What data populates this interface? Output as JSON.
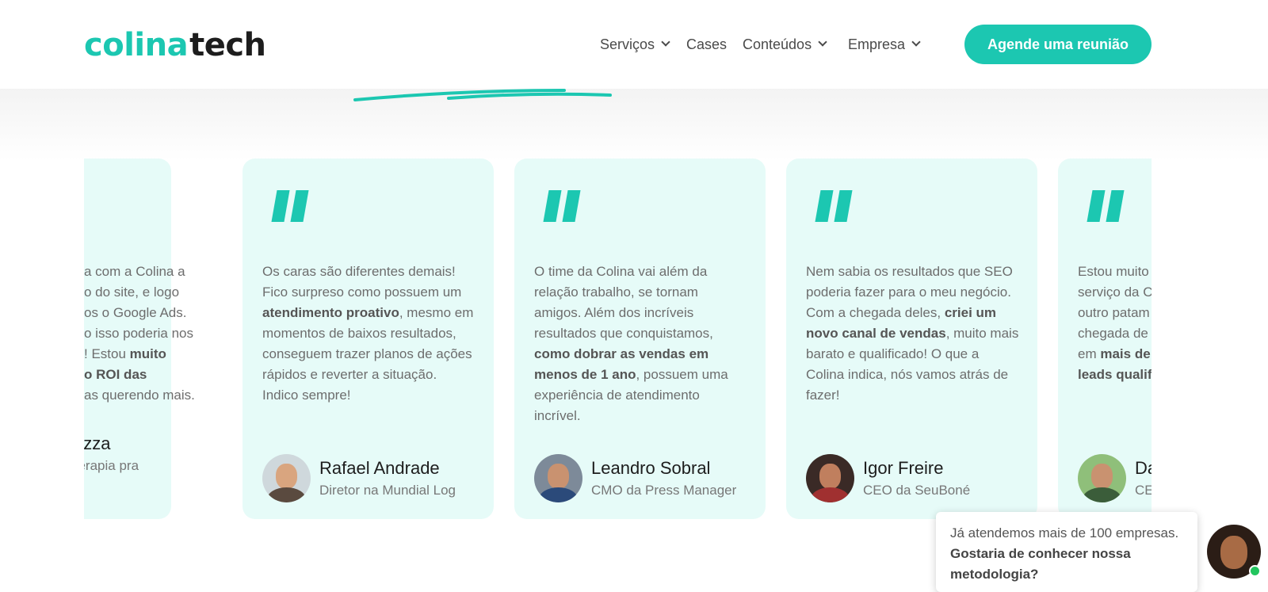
{
  "header": {
    "logo_part1": "colina",
    "logo_part2": "tech",
    "nav": [
      {
        "label": "Serviços",
        "has_dropdown": true
      },
      {
        "label": "Cases",
        "has_dropdown": false
      },
      {
        "label": "Conteúdos",
        "has_dropdown": true
      },
      {
        "label": "Empresa",
        "has_dropdown": true
      }
    ],
    "cta": "Agende uma reunião"
  },
  "colors": {
    "accent": "#1cc7b1",
    "card_bg": "#e6fbf8",
    "text": "#6d6d6d"
  },
  "testimonials": [
    {
      "text_html": "a com a Colina a<br>o do site, e logo<br>os o Google Ads.<br>o isso poderia nos<br>! Estou <b>muito</b><br><b>o ROI das</b><br>as querendo mais.",
      "name": "ina Piazza",
      "role": "a Psicoterapia pra"
    },
    {
      "text_html": "Os caras são diferentes demais! Fico surpreso como possuem um <b>atendimento proativo</b>, mesmo em momentos de baixos resultados, conseguem trazer planos de ações rápidos e reverter a situação. Indico sempre!",
      "name": "Rafael Andrade",
      "role": "Diretor na Mundial Log"
    },
    {
      "text_html": "O time da Colina vai além da relação trabalho, se tornam amigos. Além dos incríveis resultados que conquistamos, <b>como dobrar as vendas em menos de 1 ano</b>, possuem uma experiência de atendimento incrível.",
      "name": "Leandro Sobral",
      "role": "CMO da Press Manager"
    },
    {
      "text_html": "Nem sabia os resultados que SEO poderia fazer para o meu negócio. Com a chegada deles, <b>criei um novo canal de vendas</b>, muito mais barato e qualificado! O que a Colina indica, nós vamos atrás de fazer!",
      "name": "Igor Freire",
      "role": "CEO da SeuBoné"
    },
    {
      "text_html": "Estou muito<br>serviço da Co<br>outro patam<br>chegada de v<br>em <b>mais de</b><br><b>leads qualif</b>",
      "name": "Da",
      "role": "CE"
    }
  ],
  "chat": {
    "text_plain": "Já atendemos mais de 100 empresas. ",
    "text_bold": "Gostaria de conhecer nossa metodologia?"
  }
}
